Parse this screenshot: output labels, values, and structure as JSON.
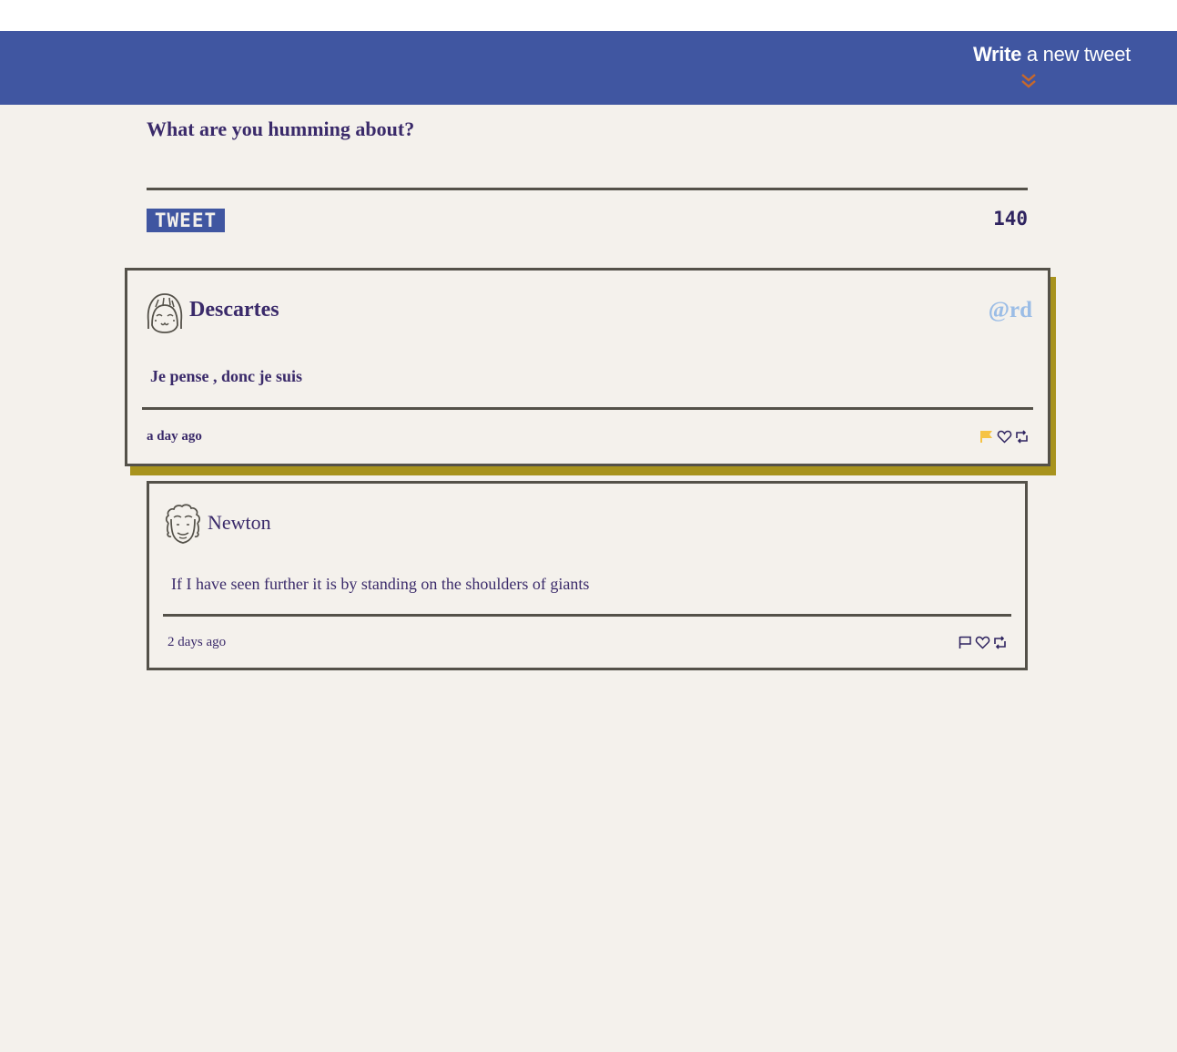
{
  "nav": {
    "write_bold": "Write",
    "write_rest": " a new tweet",
    "chevron_color": "#c8682a",
    "bar_color": "#4056a1"
  },
  "composer": {
    "label": "What are you humming about?",
    "textarea_value": "",
    "button_label": "TWEET",
    "counter": "140"
  },
  "tweets": [
    {
      "author": "Descartes",
      "handle": "@rd",
      "avatar_icon": "girl-face-icon",
      "text": "Je pense , donc je suis",
      "timestamp": "a day ago",
      "hovered": true,
      "flag_color": "#f6c344",
      "actions": [
        "flag-icon",
        "heart-icon",
        "retweet-icon"
      ]
    },
    {
      "author": "Newton",
      "handle": "",
      "avatar_icon": "curly-hair-face-icon",
      "text": "If I have seen further it is by standing on the shoulders of giants",
      "timestamp": "2 days ago",
      "hovered": false,
      "actions": [
        "flag-icon",
        "heart-icon",
        "retweet-icon"
      ]
    }
  ],
  "colors": {
    "background": "#f4f1ec",
    "text": "#3a2a6a",
    "border": "#545149",
    "shadow": "#a8931d",
    "handle": "#9bbde6"
  }
}
